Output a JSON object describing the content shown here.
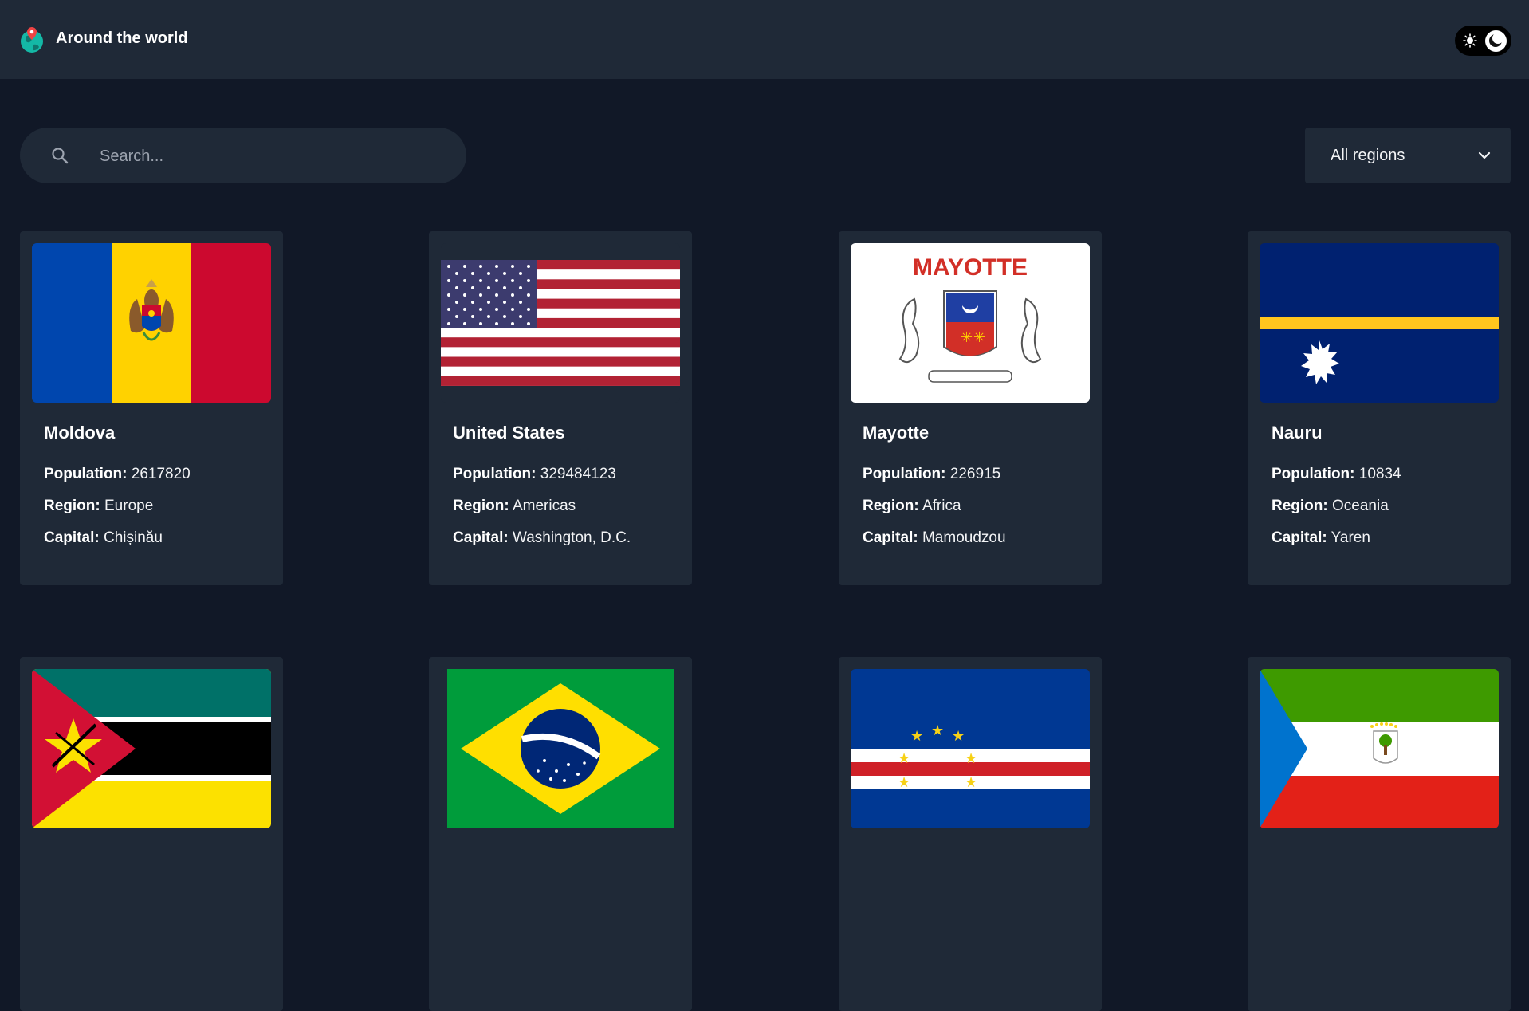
{
  "header": {
    "title": "Around the world",
    "logo_icon": "globe-pin-icon",
    "theme_toggle_icons": [
      "sun-icon",
      "moon-icon"
    ]
  },
  "search": {
    "placeholder": "Search...",
    "value": "",
    "icon": "search-icon"
  },
  "filter": {
    "selected": "All regions",
    "icon": "chevron-down-icon"
  },
  "labels": {
    "population": "Population:",
    "region": "Region:",
    "capital": "Capital:"
  },
  "countries": [
    {
      "name": "Moldova",
      "population": "2617820",
      "region": "Europe",
      "capital": "Chișinău"
    },
    {
      "name": "United States",
      "population": "329484123",
      "region": "Americas",
      "capital": "Washington, D.C."
    },
    {
      "name": "Mayotte",
      "population": "226915",
      "region": "Africa",
      "capital": "Mamoudzou",
      "flag_text": "MAYOTTE"
    },
    {
      "name": "Nauru",
      "population": "10834",
      "region": "Oceania",
      "capital": "Yaren"
    },
    {
      "name": "",
      "flag": "Mozambique"
    },
    {
      "name": "",
      "flag": "Brazil",
      "flag_text": "ORDEM E PROGRESSO"
    },
    {
      "name": "",
      "flag": "Cape Verde"
    },
    {
      "name": "",
      "flag": "Equatorial Guinea"
    }
  ],
  "colors": {
    "background": "#111827",
    "surface": "#1f2937",
    "text": "#ffffff"
  }
}
